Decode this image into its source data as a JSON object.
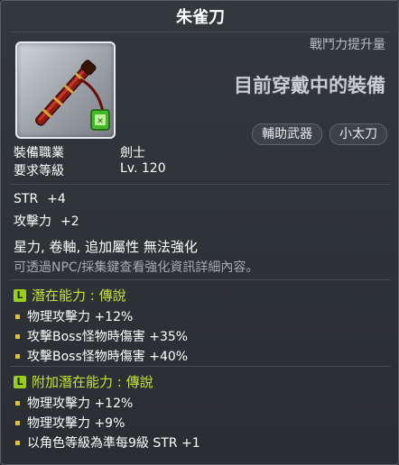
{
  "title": "朱雀刀",
  "power_label": "戰鬥力提升量",
  "equipped_label": "目前穿戴中的裝備",
  "badges": [
    "輔助武器",
    "小太刀"
  ],
  "requirements": [
    {
      "label": "裝備職業",
      "value": "劍士"
    },
    {
      "label": "要求等級",
      "value": "Lv. 120"
    }
  ],
  "stats": [
    {
      "name": "STR",
      "value": "+4"
    },
    {
      "name": "攻擊力",
      "value": "+2"
    }
  ],
  "notes": {
    "restriction": "星力, 卷軸, 追加屬性 無法強化",
    "hint": "可透過NPC/採集鍵查看強化資訊詳細內容。"
  },
  "potential": {
    "grade_letter": "L",
    "title": "潛在能力 : 傳說",
    "lines": [
      "物理攻擊力 +12%",
      "攻擊Boss怪物時傷害 +35%",
      "攻擊Boss怪物時傷害 +40%"
    ]
  },
  "bonus_potential": {
    "grade_letter": "L",
    "title": "附加潛在能力 : 傳說",
    "lines": [
      "物理攻擊力 +12%",
      "物理攻擊力 +9%",
      "以角色等級為準每9級 STR +1"
    ]
  },
  "colors": {
    "potential_title": "#c6e23a",
    "grade_icon": "#9acd1e",
    "bullet": "#e6c21c"
  },
  "icons": {
    "item": "red-katana-with-green-charm-icon"
  }
}
